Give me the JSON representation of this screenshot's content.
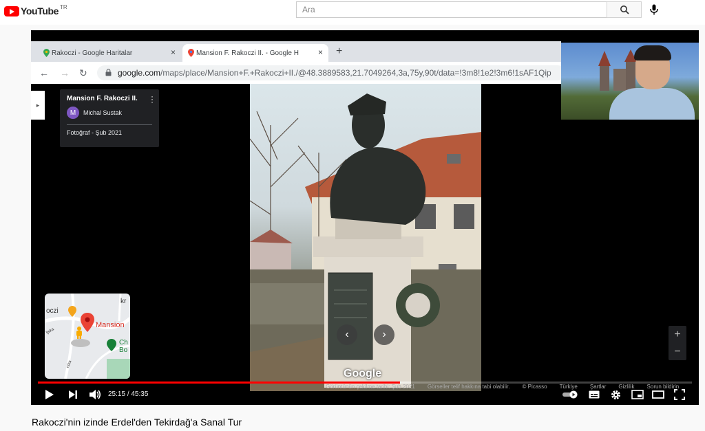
{
  "masthead": {
    "logo_word": "YouTube",
    "country_code": "TR",
    "search_placeholder": "Ara"
  },
  "browser": {
    "tabs": [
      {
        "label": "Rakoczi - Google Haritalar"
      },
      {
        "label": "Mansion F. Rakoczi II. - Google H"
      }
    ],
    "url_host": "google.com",
    "url_path": "/maps/place/Mansion+F.+Rakoczi+II./@48.3889583,21.7049264,3a,75y,90t/data=!3m8!1e2!3m6!1sAF1Qip"
  },
  "place_card": {
    "title": "Mansion F. Rakoczi II.",
    "author_initial": "M",
    "author": "Michal Sustak",
    "photo_date": "Fotoğraf - Şub 2021"
  },
  "minimap": {
    "label_left": "oczi",
    "label_right": "Mansion",
    "label_top": "kr",
    "label_green": "Ch\nBo",
    "label_road": "ljska",
    "label_road2": "rska"
  },
  "streetview": {
    "watermark": "Google",
    "attribution": [
      "Görüntünün çekilme tarihi: Şub 2021",
      "Görseller telif hakkına tabi olabilir.",
      "© Picasso",
      "Türkiye",
      "Şartlar",
      "Gizlilik",
      "Sorun bildirin"
    ]
  },
  "player": {
    "current_time": "25:15",
    "duration": "45:35",
    "time_separator": "/",
    "progress": 0.554,
    "buffered": 0.57
  },
  "video": {
    "title": "Rakoczi'nin izinde Erdel'den Tekirdağ'a Sanal Tur"
  },
  "colors": {
    "accent": "#ff0000",
    "avatar": "#7e57c2"
  }
}
